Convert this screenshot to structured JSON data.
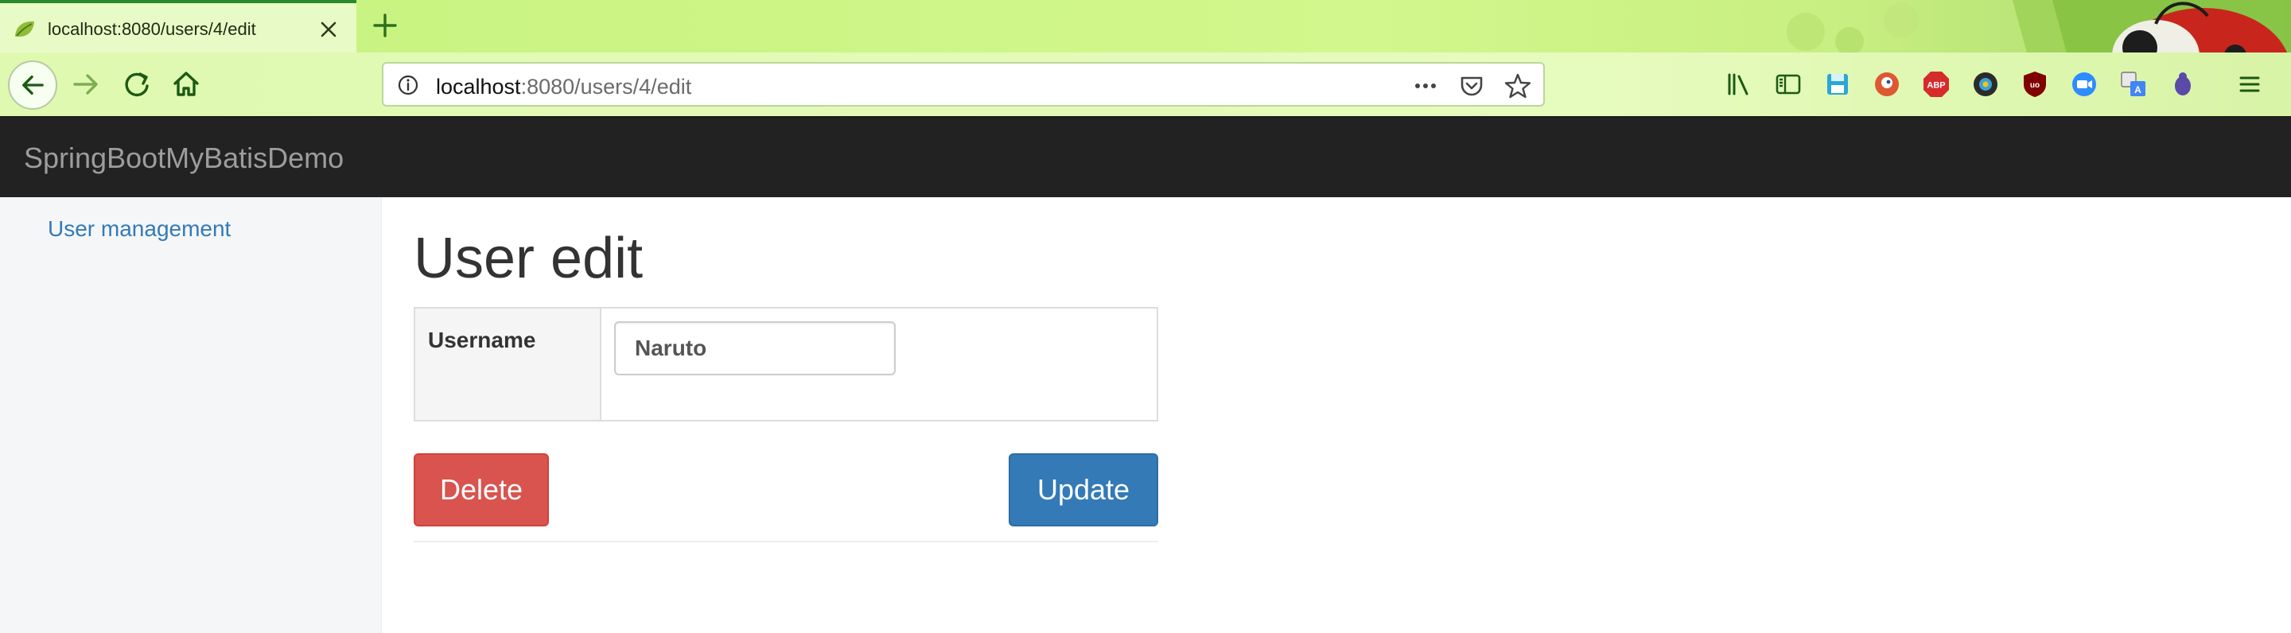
{
  "browser": {
    "tab": {
      "title": "localhost:8080/users/4/edit"
    },
    "url": {
      "host": "localhost",
      "path": ":8080/users/4/edit"
    },
    "toolbar_icons": [
      "library-icon",
      "sidebar-icon",
      "save-icon",
      "duckduckgo-icon",
      "adblock-plus-icon",
      "extension-icon",
      "ublock-origin-icon",
      "zoom-icon",
      "translate-icon",
      "bug-icon",
      "menu-icon"
    ]
  },
  "app": {
    "brand": "SpringBootMyBatisDemo"
  },
  "sidebar": {
    "items": [
      {
        "label": "User management"
      }
    ]
  },
  "main": {
    "title": "User edit",
    "form": {
      "username_label": "Username",
      "username_value": "Naruto"
    },
    "buttons": {
      "delete": "Delete",
      "update": "Update"
    }
  },
  "colors": {
    "header_bg": "#222222",
    "link": "#337ab7",
    "danger": "#d9534f",
    "primary": "#337ab7"
  }
}
